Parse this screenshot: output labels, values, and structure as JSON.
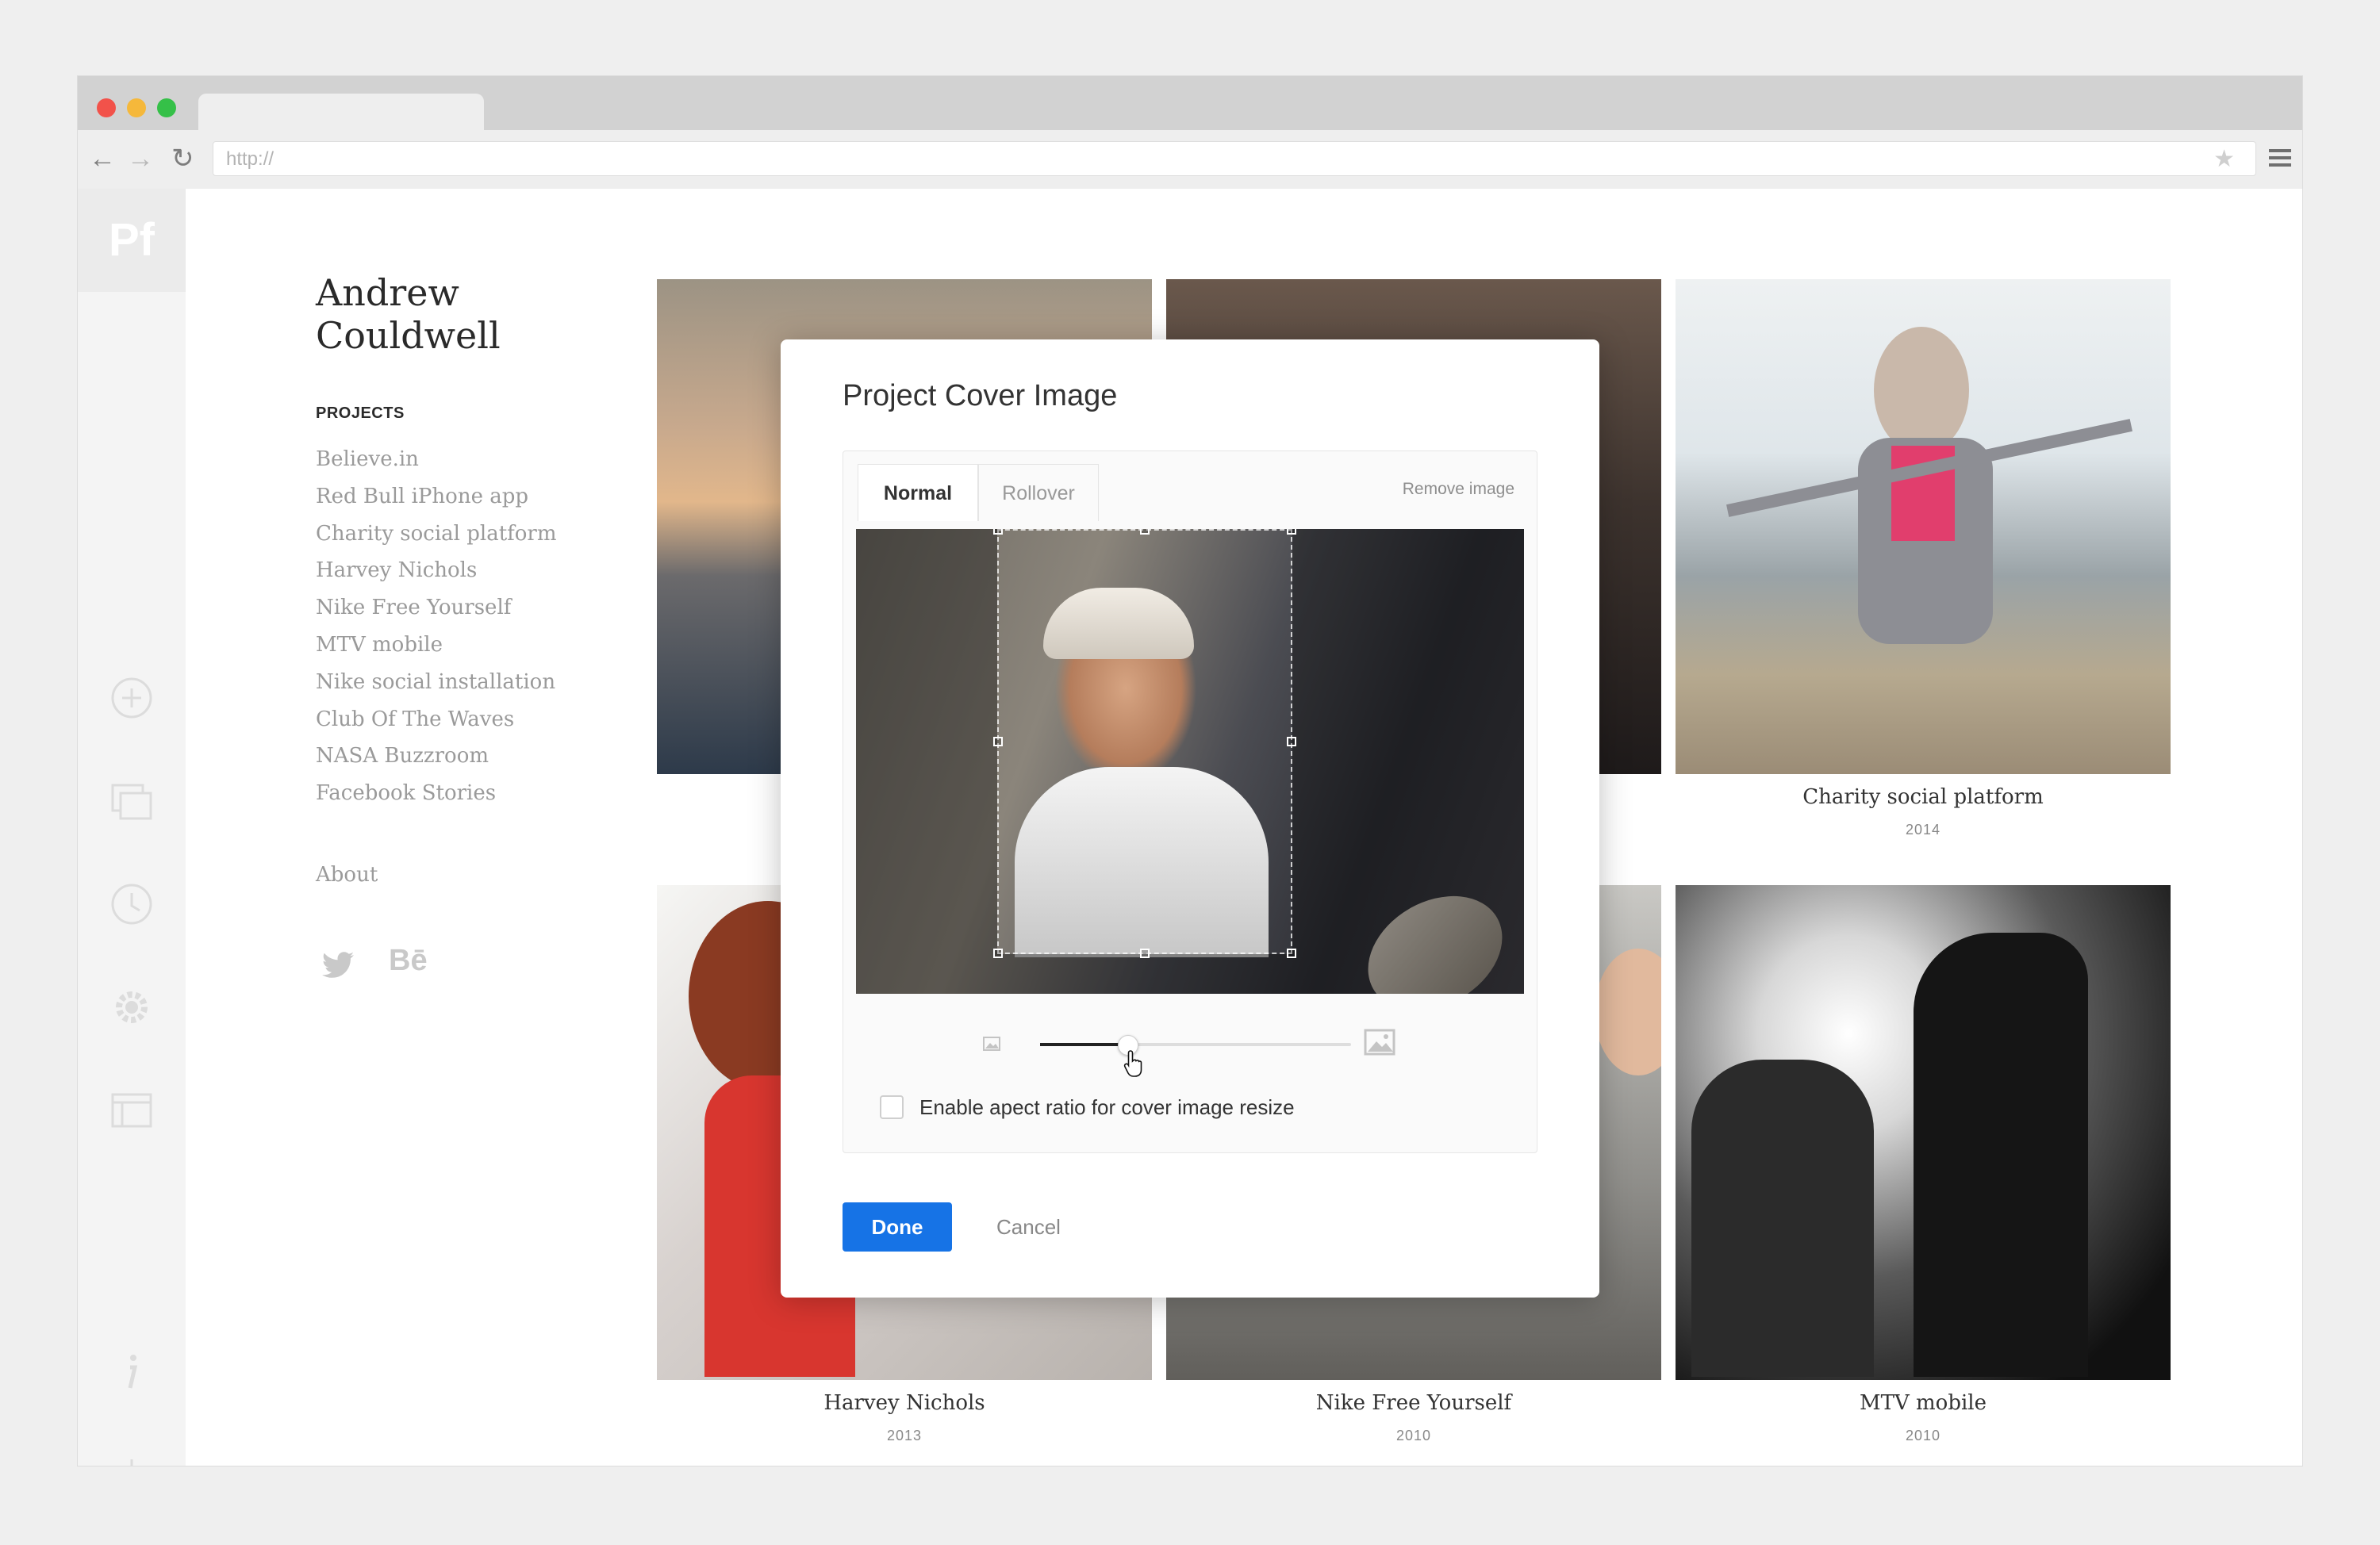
{
  "browser": {
    "url": "http://"
  },
  "app": {
    "logo": "Pf"
  },
  "site": {
    "name": "Andrew Couldwell",
    "projects_heading": "PROJECTS",
    "projects": [
      "Believe.in",
      "Red Bull iPhone app",
      "Charity social platform",
      "Harvey Nichols",
      "Nike Free Yourself",
      "MTV mobile",
      "Nike social installation",
      "Club Of The Waves",
      "NASA Buzzroom",
      "Facebook Stories"
    ],
    "about": "About",
    "social": {
      "behance_label": "Bē"
    }
  },
  "grid": {
    "items": [
      {
        "title": "Charity social platform",
        "year": "2014"
      },
      {
        "title": "Harvey Nichols",
        "year": "2013"
      },
      {
        "title": "Nike Free Yourself",
        "year": "2010"
      },
      {
        "title": "MTV mobile",
        "year": "2010"
      }
    ]
  },
  "modal": {
    "title": "Project Cover Image",
    "tabs": [
      "Normal",
      "Rollover"
    ],
    "active_tab": "Normal",
    "remove_image": "Remove image",
    "zoom_level": 0.28,
    "aspect_checkbox": {
      "label": "Enable apect ratio for cover image resize",
      "checked": false
    },
    "done": "Done",
    "cancel": "Cancel"
  },
  "colors": {
    "primary_button": "#1673e6",
    "traffic_red": "#f2524a",
    "traffic_yellow": "#f5b83b",
    "traffic_green": "#35c048"
  }
}
